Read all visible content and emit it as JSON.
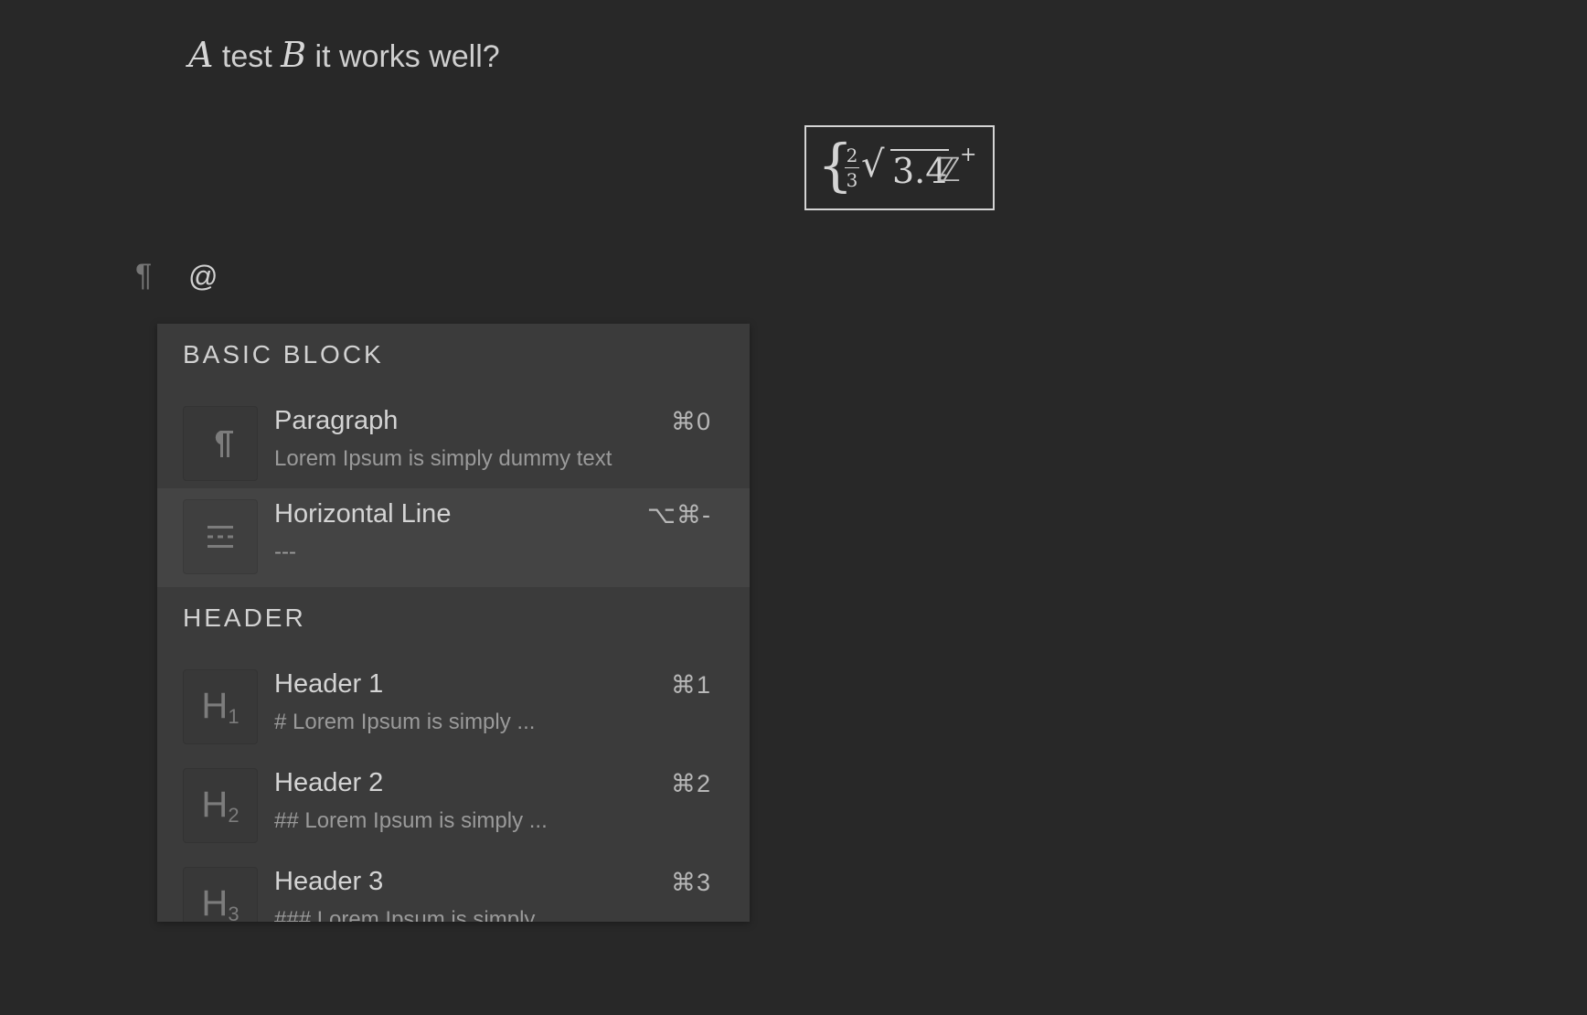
{
  "content": {
    "line1": {
      "var_a": "A",
      "text_1": " test ",
      "var_b": "B",
      "text_2": " it works well?"
    },
    "math_block": {
      "numerator": "2",
      "denominator": "3",
      "radical": "√",
      "radicand": "3.4",
      "set": "ℤ",
      "superscript": "+"
    },
    "current_input": "@"
  },
  "menu": {
    "sections": [
      {
        "title": "BASIC BLOCK",
        "items": [
          {
            "label": "Paragraph",
            "description": "Lorem Ipsum is simply dummy text",
            "shortcut": "⌘0",
            "icon": "paragraph-icon"
          },
          {
            "label": "Horizontal Line",
            "description": "---",
            "shortcut": "⌥⌘-",
            "icon": "horizontal-line-icon",
            "active": true
          }
        ]
      },
      {
        "title": "HEADER",
        "items": [
          {
            "label": "Header 1",
            "description": "# Lorem Ipsum is simply ...",
            "shortcut": "⌘1",
            "icon": "header-1-icon"
          },
          {
            "label": "Header 2",
            "description": "## Lorem Ipsum is simply ...",
            "shortcut": "⌘2",
            "icon": "header-2-icon"
          },
          {
            "label": "Header 3",
            "description": "### Lorem Ipsum is simply ...",
            "shortcut": "⌘3",
            "icon": "header-3-icon"
          }
        ]
      }
    ]
  },
  "colors": {
    "background": "#282828",
    "menu_background": "#3b3b3b",
    "menu_active": "#444444"
  }
}
